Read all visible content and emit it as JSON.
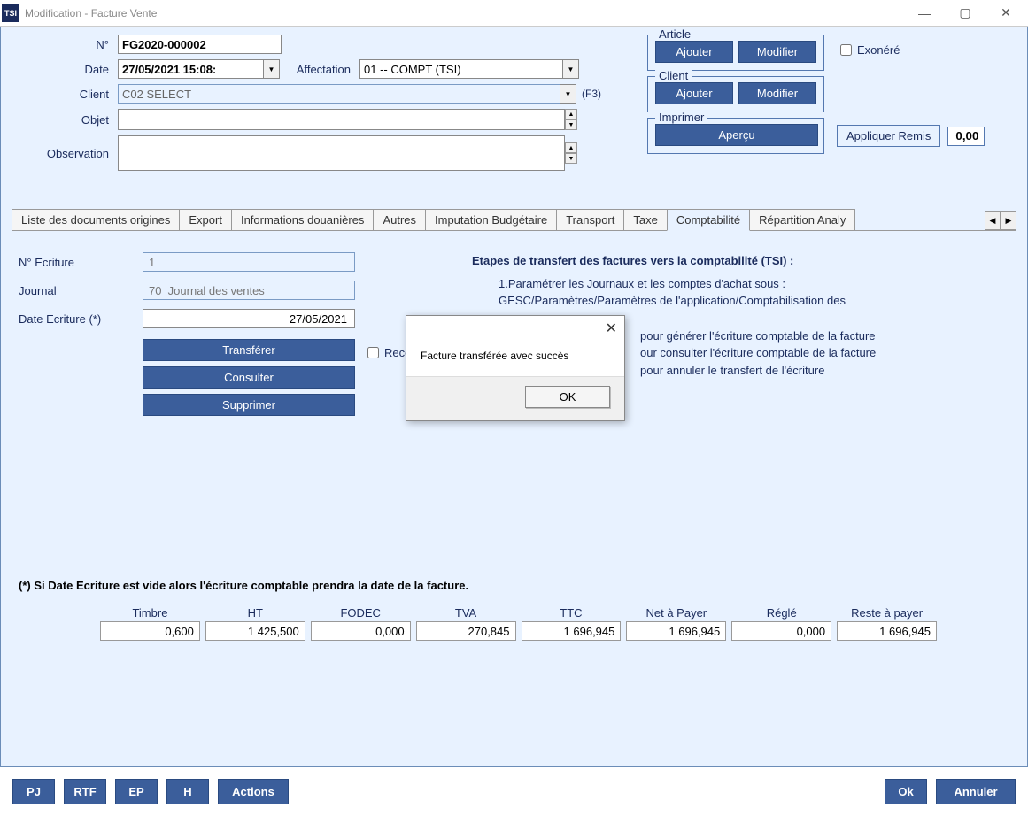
{
  "window": {
    "title": "Modification - Facture Vente",
    "icon_text": "TSI"
  },
  "header": {
    "labels": {
      "num": "N°",
      "date": "Date",
      "affect": "Affectation",
      "client": "Client",
      "objet": "Objet",
      "obs": "Observation",
      "f3": "(F3)"
    },
    "num": "FG2020-000002",
    "date": "27/05/2021 15:08:",
    "affect": "01 -- COMPT (TSI)",
    "client": "C02 SELECT",
    "objet": "",
    "obs": ""
  },
  "panels": {
    "article": {
      "legend": "Article",
      "add": "Ajouter",
      "edit": "Modifier"
    },
    "client": {
      "legend": "Client",
      "add": "Ajouter",
      "edit": "Modifier"
    },
    "print": {
      "legend": "Imprimer",
      "preview": "Aperçu"
    },
    "exonere": "Exonéré",
    "remis": {
      "btn": "Appliquer Remis",
      "val": "0,00"
    }
  },
  "tabs": {
    "items": [
      "Liste des documents origines",
      "Export",
      "Informations douanières",
      "Autres",
      "Imputation Budgétaire",
      "Transport",
      "Taxe",
      "Comptabilité",
      "Répartition Analy"
    ],
    "active": 7
  },
  "compta": {
    "labels": {
      "num": "N° Ecriture",
      "journal": "Journal",
      "date": "Date Ecriture (*)",
      "transfer": "Transférer",
      "consult": "Consulter",
      "delete": "Supprimer",
      "recalc": "Rece"
    },
    "num": "1",
    "journal": "70  Journal des ventes",
    "date": "27/05/2021",
    "steps_title": "Etapes de transfert des factures vers la comptabilité (TSI) :",
    "step1a": "1.Paramétrer les Journaux et les comptes d'achat sous :",
    "step1b": "GESC/Paramètres/Paramètres de l'application/Comptabilisation des",
    "step2": "pour générer l'écriture comptable de la facture",
    "step3": "our consulter l'écriture comptable de la facture",
    "step4": "pour annuler le transfert  de l'écriture",
    "note": "(*) Si Date Ecriture est vide alors l'écriture comptable prendra la date de la facture."
  },
  "totals": {
    "labels": [
      "Timbre",
      "HT",
      "FODEC",
      "TVA",
      "TTC",
      "Net à Payer",
      "Réglé",
      "Reste à payer"
    ],
    "values": [
      "0,600",
      "1 425,500",
      "0,000",
      "270,845",
      "1 696,945",
      "1 696,945",
      "0,000",
      "1 696,945"
    ]
  },
  "bottom": {
    "pj": "PJ",
    "rtf": "RTF",
    "ep": "EP",
    "h": "H",
    "actions": "Actions",
    "ok": "Ok",
    "cancel": "Annuler"
  },
  "modal": {
    "msg": "Facture transférée avec succès",
    "ok": "OK"
  }
}
